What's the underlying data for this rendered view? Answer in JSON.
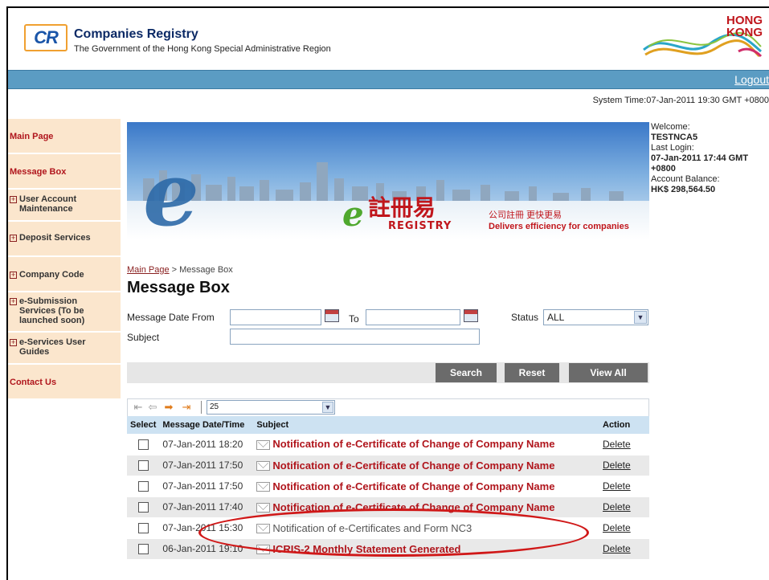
{
  "header": {
    "logo_text": "CR",
    "org_title": "Companies Registry",
    "org_subtitle": "The Government of the Hong Kong Special Administrative Region",
    "brand_line1": "HONG",
    "brand_line2": "KONG"
  },
  "topbar": {
    "logout_label": "Logout"
  },
  "system_time": "System Time:07-Jan-2011 19:30 GMT +0800",
  "sidebar": {
    "items": [
      {
        "label": "Main Page",
        "expandable": false
      },
      {
        "label": "Message Box",
        "expandable": false
      },
      {
        "label": "User Account Maintenance",
        "expandable": true
      },
      {
        "label": "Deposit Services",
        "expandable": true
      },
      {
        "label": "Company Code",
        "expandable": true
      },
      {
        "label": "e-Submission Services (To be launched soon)",
        "expandable": true
      },
      {
        "label": "e-Services User Guides",
        "expandable": true
      },
      {
        "label": "Contact Us",
        "expandable": false
      }
    ]
  },
  "banner": {
    "brand_chinese": "註冊易",
    "brand_english": "REGISTRY",
    "slogan_chinese": "公司註冊 更快更易",
    "slogan_english": "Delivers efficiency for companies"
  },
  "welcome": {
    "welcome_label": "Welcome:",
    "user": "TESTNCA5",
    "last_login_label": "Last Login:",
    "last_login_value": "07-Jan-2011 17:44 GMT +0800",
    "balance_label": "Account Balance:",
    "balance_value": "HK$ 298,564.50"
  },
  "breadcrumb": {
    "home": "Main Page",
    "separator": " > ",
    "current": "Message Box"
  },
  "page_title": "Message Box",
  "filters": {
    "date_from_label": "Message Date From",
    "date_from_value": "",
    "to_label": "To",
    "date_to_value": "",
    "status_label": "Status",
    "status_value": "ALL",
    "subject_label": "Subject",
    "subject_value": ""
  },
  "buttons": {
    "search": "Search",
    "reset": "Reset",
    "view_all": "View All"
  },
  "pager": {
    "page_size": "25"
  },
  "table": {
    "headers": {
      "select": "Select",
      "date": "Message Date/Time",
      "subject": "Subject",
      "action": "Action"
    },
    "rows": [
      {
        "date": "07-Jan-2011 18:20",
        "subject": "Notification of e-Certificate of Change of Company Name",
        "action": "Delete",
        "read": false
      },
      {
        "date": "07-Jan-2011 17:50",
        "subject": "Notification of e-Certificate of Change of Company Name",
        "action": "Delete",
        "read": false
      },
      {
        "date": "07-Jan-2011 17:50",
        "subject": "Notification of e-Certificate of Change of Company Name",
        "action": "Delete",
        "read": false
      },
      {
        "date": "07-Jan-2011 17:40",
        "subject": "Notification of e-Certificate of Change of Company Name",
        "action": "Delete",
        "read": false
      },
      {
        "date": "07-Jan-2011 15:30",
        "subject": "Notification of e-Certificates and Form NC3",
        "action": "Delete",
        "read": true
      },
      {
        "date": "06-Jan-2011 19:10",
        "subject": "ICRIS-2 Monthly Statement Generated",
        "action": "Delete",
        "read": false
      }
    ]
  },
  "colors": {
    "topbar": "#5b9cc3",
    "sidebar_bg": "#fbe6cd",
    "accent_red": "#b0151c",
    "highlight": "#d01818"
  }
}
